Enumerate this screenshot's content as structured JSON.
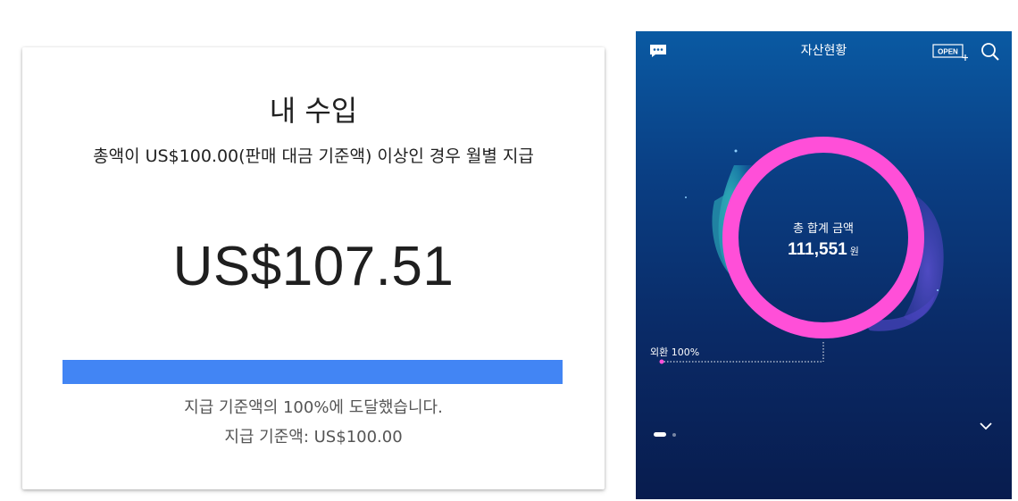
{
  "income_card": {
    "title": "내 수입",
    "subtitle": "총액이 US$100.00(판매 대금 기준액) 이상인 경우 월별 지급",
    "amount": "US$107.51",
    "progress_percent": 100,
    "progress_status": "지급 기준액의 100%에 도달했습니다.",
    "threshold_text": "지급 기준액: US$100.00",
    "colors": {
      "progress": "#4285f4",
      "track": "#e0e0e0"
    }
  },
  "asset_panel": {
    "title": "자산현황",
    "open_badge": "OPEN",
    "icons": [
      "chat-icon",
      "open-icon",
      "search-icon",
      "chevron-down-icon"
    ],
    "total_label": "총 합계 금액",
    "total_value": "111,551",
    "total_unit": "원",
    "breakdown": [
      {
        "label": "외환 100%",
        "percent": 100,
        "color": "#ff4fd8"
      }
    ],
    "pager": {
      "pages": 2,
      "active": 1
    },
    "colors": {
      "ring": "#ff4fd8",
      "background_top": "#0a5aa3",
      "background_bottom": "#081c4e"
    }
  }
}
